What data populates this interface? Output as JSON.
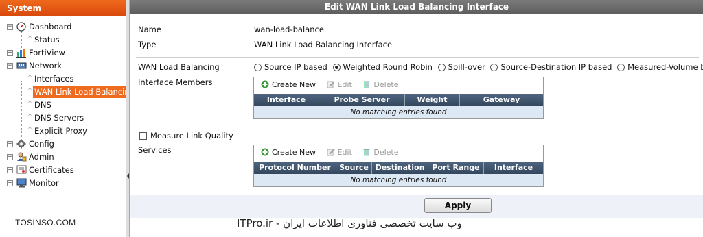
{
  "sidebar": {
    "title": "System",
    "items": [
      {
        "label": "Dashboard",
        "icon": "dashboard-icon",
        "toggle": "-"
      },
      {
        "label": "Status",
        "child": true
      },
      {
        "label": "FortiView",
        "icon": "fortiview-icon",
        "toggle": "+"
      },
      {
        "label": "Network",
        "icon": "network-icon",
        "toggle": "-"
      },
      {
        "label": "Interfaces",
        "child": true
      },
      {
        "label": "WAN Link Load Balancing",
        "child": true,
        "selected": true
      },
      {
        "label": "DNS",
        "child": true
      },
      {
        "label": "DNS Servers",
        "child": true
      },
      {
        "label": "Explicit Proxy",
        "child": true
      },
      {
        "label": "Config",
        "icon": "config-icon",
        "toggle": "+"
      },
      {
        "label": "Admin",
        "icon": "admin-icon",
        "toggle": "+"
      },
      {
        "label": "Certificates",
        "icon": "certificates-icon",
        "toggle": "+"
      },
      {
        "label": "Monitor",
        "icon": "monitor-icon",
        "toggle": "+"
      }
    ]
  },
  "main": {
    "title": "Edit WAN Link Load Balancing Interface",
    "name_label": "Name",
    "name_value": "wan-load-balance",
    "type_label": "Type",
    "type_value": "WAN Link Load Balancing Interface",
    "wlb_label": "WAN Load Balancing",
    "wlb_options": [
      "Source IP based",
      "Weighted Round Robin",
      "Spill-over",
      "Source-Destination IP based",
      "Measured-Volume based"
    ],
    "wlb_selected": "Weighted Round Robin",
    "members_label": "Interface Members",
    "members_grid": {
      "create": "Create New",
      "edit": "Edit",
      "delete": "Delete",
      "columns": [
        "Interface",
        "Probe Server",
        "Weight",
        "Gateway"
      ],
      "empty": "No matching entries found"
    },
    "measure_label": "Measure Link Quality",
    "measure_checked": false,
    "services_label": "Services",
    "services_grid": {
      "create": "Create New",
      "edit": "Edit",
      "delete": "Delete",
      "columns": [
        "Protocol Number",
        "Source",
        "Destination",
        "Port Range",
        "Interface"
      ],
      "empty": "No matching entries found"
    },
    "apply_label": "Apply"
  },
  "watermarks": {
    "left": "TOSINSO.COM",
    "right": "ITPro.ir - وب سایت تخصصی فناوری اطلاعات ایران"
  },
  "colors": {
    "accent": "#ef6a1c",
    "grid_header": "#3f546e",
    "empty_row": "#dde8f5"
  }
}
